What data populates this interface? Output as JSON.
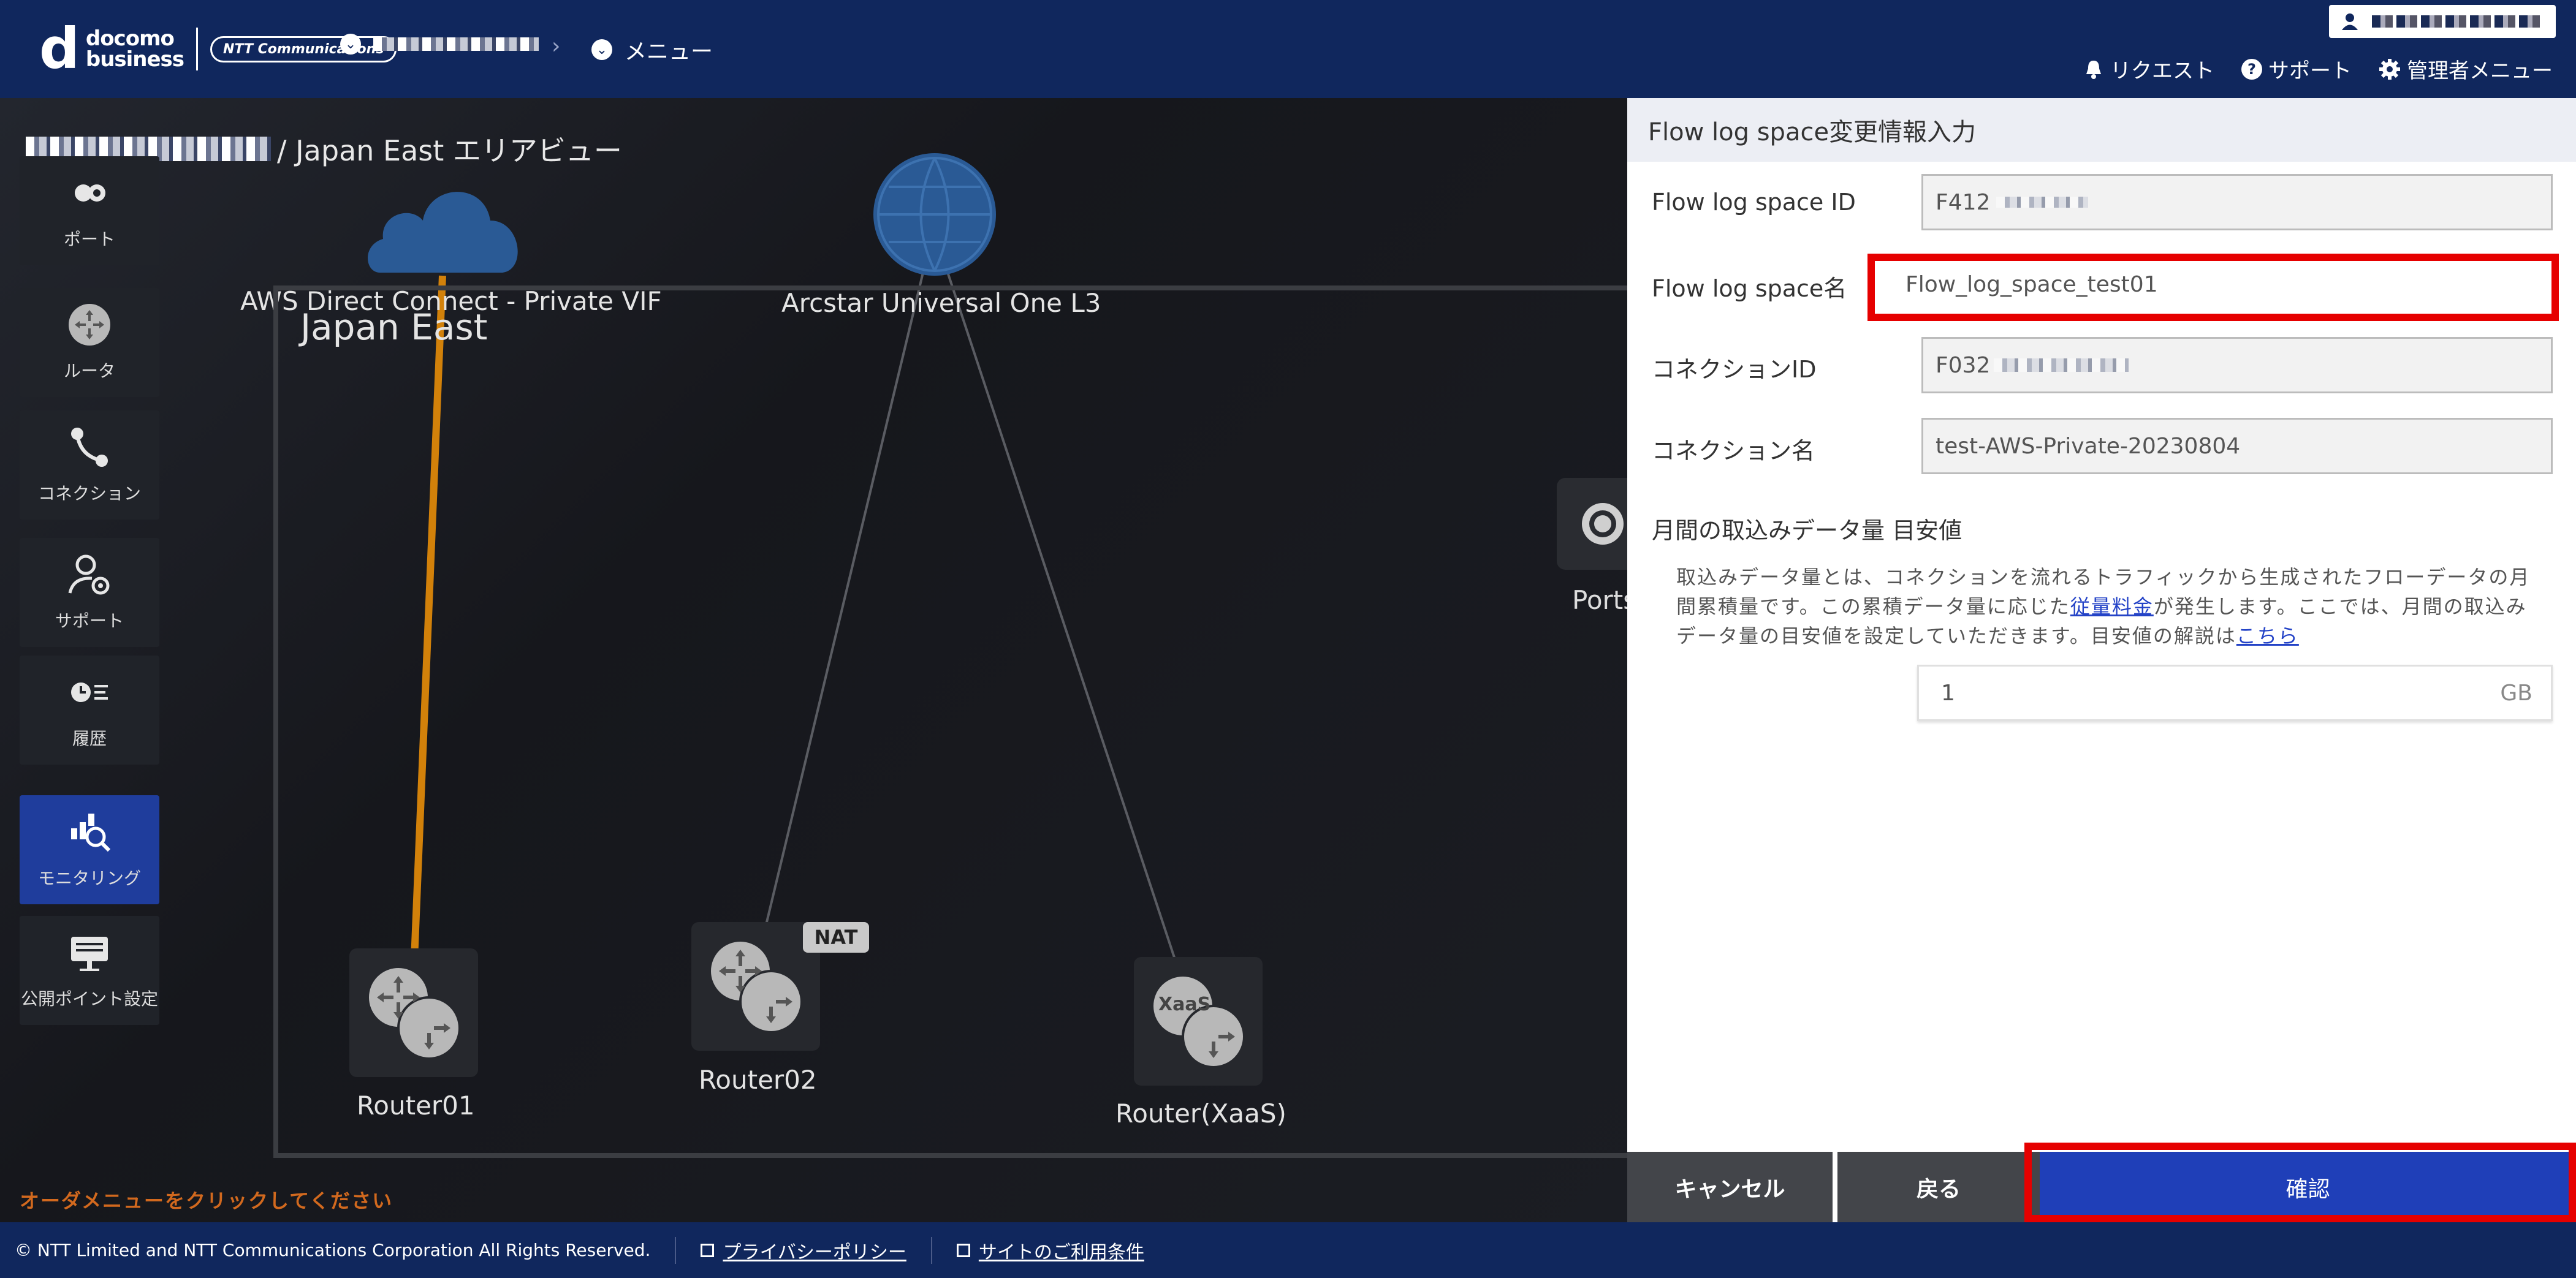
{
  "header": {
    "logo_brand": "d",
    "logo_line1": "docomo",
    "logo_line2": "business",
    "ntt_badge": "NTT Communications",
    "breadcrumb_menu": "メニュー",
    "links": {
      "request": "リクエスト",
      "support": "サポート",
      "admin_menu": "管理者メニュー"
    }
  },
  "canvas": {
    "area_title": "/ Japan East エリアビュー",
    "sidebar": [
      {
        "label": "ポート",
        "icon": "port-icon"
      },
      {
        "label": "ルータ",
        "icon": "router-icon"
      },
      {
        "label": "コネクション",
        "icon": "connection-icon"
      },
      {
        "label": "サポート",
        "icon": "support-icon"
      },
      {
        "label": "履歴",
        "icon": "history-icon"
      },
      {
        "label": "モニタリング",
        "icon": "monitoring-icon"
      },
      {
        "label": "公開ポイント設定",
        "icon": "public-point-icon"
      }
    ],
    "clouds": {
      "aws": "AWS Direct Connect - Private VIF",
      "arcstar": "Arcstar Universal One L3"
    },
    "zone_label": "Japan East",
    "routers": {
      "router01": "Router01",
      "router02": "Router02",
      "router_xaas": "Router(XaaS)",
      "nat_badge": "NAT",
      "xaas_text": "XaaS"
    },
    "ports_label": "Ports",
    "order_hint": "オーダメニューをクリックしてください"
  },
  "panel": {
    "title": "Flow log space変更情報入力",
    "fields": {
      "flow_log_space_id_label": "Flow log space ID",
      "flow_log_space_id_value": "F412",
      "flow_log_space_name_label": "Flow log space名",
      "flow_log_space_name_value": "Flow_log_space_test01",
      "connection_id_label": "コネクションID",
      "connection_id_value": "F032",
      "connection_name_label": "コネクション名",
      "connection_name_value": "test-AWS-Private-20230804"
    },
    "monthly_label": "月間の取込みデータ量 目安値",
    "desc": {
      "part1": "取込みデータ量とは、コネクションを流れるトラフィックから生成されたフローデータの月間累積量です。この累積データ量に応じた",
      "link1": "従量料金",
      "part2": "が発生します。ここでは、月間の取込みデータ量の目安値を設定していただきます。目安値の解説は",
      "link2": "こちら"
    },
    "gb_value": "1",
    "gb_unit": "GB",
    "buttons": {
      "cancel": "キャンセル",
      "back": "戻る",
      "confirm": "確認"
    }
  },
  "footer": {
    "copyright": "© NTT Limited and NTT Communications Corporation All Rights Reserved.",
    "privacy": "プライバシーポリシー",
    "terms": "サイトのご利用条件"
  },
  "colors": {
    "header_bg": "#10275d",
    "accent_blue": "#1f3fb8",
    "highlight_red": "#e60000",
    "aws_link": "#d2810a"
  }
}
